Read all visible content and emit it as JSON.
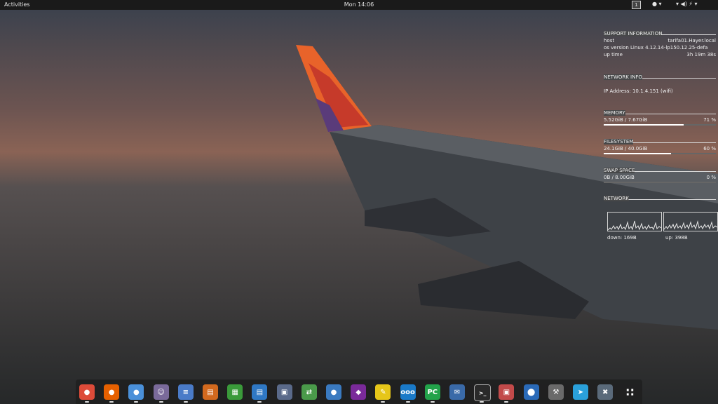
{
  "topbar": {
    "activities": "Activities",
    "clock": "Mon 14:06",
    "workspace": "1",
    "tray_accessibility": "● ▾",
    "tray_system": "▾ ◀) ⚡ ▾"
  },
  "conky": {
    "support": {
      "title": "SUPPORT INFORMATION",
      "host_label": "host",
      "host_value": "tarifa01.Hayer.local",
      "os_label": "os version",
      "os_value": "Linux 4.12.14-lp150.12.25-defa",
      "uptime_label": "up time",
      "uptime_value": "3h 19m 38s"
    },
    "network_info": {
      "title": "NETWORK INFO",
      "ip_line": "IP Address: 10.1.4.151 (wifi)"
    },
    "memory": {
      "title": "MEMORY",
      "value": "5.52GiB / 7.67GiB",
      "percent": "71 %",
      "fraction": 0.71
    },
    "filesystem": {
      "title": "FILESYSTEM",
      "value": "24.1GiB / 40.0GiB",
      "percent": "60 %",
      "fraction": 0.6
    },
    "swap": {
      "title": "SWAP SPACE",
      "value": "0B  / 8.00GiB",
      "percent": "0 %",
      "fraction": 0.0
    },
    "network": {
      "title": "NETWORK",
      "down": "down: 169B",
      "up": "up: 398B"
    }
  },
  "dock": {
    "apps": [
      {
        "name": "chrome-icon",
        "color": "#dd4b39",
        "glyph": "●"
      },
      {
        "name": "firefox-icon",
        "color": "#e66000",
        "glyph": "●"
      },
      {
        "name": "chromium-icon",
        "color": "#4a90d9",
        "glyph": "●"
      },
      {
        "name": "pidgin-icon",
        "color": "#7a6a9a",
        "glyph": "☺"
      },
      {
        "name": "file-manager-icon",
        "color": "#4a7bc8",
        "glyph": "≡"
      },
      {
        "name": "impress-icon",
        "color": "#d2691e",
        "glyph": "▤"
      },
      {
        "name": "calc-icon",
        "color": "#3a9a3a",
        "glyph": "▦"
      },
      {
        "name": "writer-icon",
        "color": "#2f78c4",
        "glyph": "▤"
      },
      {
        "name": "image-viewer-icon",
        "color": "#5a6a8a",
        "glyph": "▣"
      },
      {
        "name": "transfer-icon",
        "color": "#4a9a4a",
        "glyph": "⇄"
      },
      {
        "name": "chat-icon",
        "color": "#3a7ac0",
        "glyph": "●"
      },
      {
        "name": "visual-studio-icon",
        "color": "#7a2a9a",
        "glyph": "◆"
      },
      {
        "name": "notes-icon",
        "color": "#e6c619",
        "glyph": "✎"
      },
      {
        "name": "nextcloud-icon",
        "color": "#1a7ac8",
        "glyph": "ooo"
      },
      {
        "name": "pycharm-icon",
        "color": "#22a34a",
        "glyph": "PC"
      },
      {
        "name": "mail-icon",
        "color": "#3a6aa8",
        "glyph": "✉"
      },
      {
        "name": "terminal-icon",
        "color": "#2a2a2a",
        "glyph": ">_"
      },
      {
        "name": "package-icon",
        "color": "#c24a4a",
        "glyph": "▣"
      },
      {
        "name": "bluetooth-icon",
        "color": "#2a6ab8",
        "glyph": "⬤"
      },
      {
        "name": "network-tools-icon",
        "color": "#6a6a6a",
        "glyph": "⚒"
      },
      {
        "name": "telegram-icon",
        "color": "#2aa0da",
        "glyph": "➤"
      },
      {
        "name": "settings-tools-icon",
        "color": "#5a6a7a",
        "glyph": "✖"
      },
      {
        "name": "app-grid-icon",
        "color": "transparent",
        "glyph": "∷"
      }
    ]
  }
}
